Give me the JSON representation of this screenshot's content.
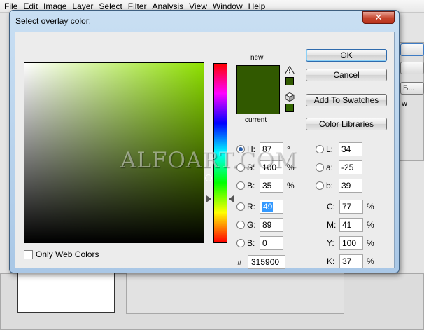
{
  "menu": [
    "File",
    "Edit",
    "Image",
    "Layer",
    "Select",
    "Filter",
    "Analysis",
    "View",
    "Window",
    "Help"
  ],
  "background": {
    "btn1": "Б...",
    "btn2": "w"
  },
  "dialog": {
    "title": "Select overlay color:",
    "close_glyph": "✕",
    "new_label": "new",
    "current_label": "current",
    "new_color": "#315900",
    "current_color": "#315900",
    "gamut_swatch_color": "#315900",
    "web_swatch_color": "#336600",
    "buttons": {
      "ok": "OK",
      "cancel": "Cancel",
      "add_swatches": "Add To Swatches",
      "color_libraries": "Color Libraries"
    },
    "only_web_colors": "Only Web Colors",
    "hsb": [
      {
        "label": "H:",
        "value": "87",
        "unit": "°"
      },
      {
        "label": "S:",
        "value": "100",
        "unit": "%"
      },
      {
        "label": "B:",
        "value": "35",
        "unit": "%"
      }
    ],
    "rgb": [
      {
        "label": "R:",
        "value": "49"
      },
      {
        "label": "G:",
        "value": "89"
      },
      {
        "label": "B:",
        "value": "0"
      }
    ],
    "lab": [
      {
        "label": "L:",
        "value": "34"
      },
      {
        "label": "a:",
        "value": "-25"
      },
      {
        "label": "b:",
        "value": "39"
      }
    ],
    "cmyk": [
      {
        "label": "C:",
        "value": "77",
        "unit": "%"
      },
      {
        "label": "M:",
        "value": "41",
        "unit": "%"
      },
      {
        "label": "Y:",
        "value": "100",
        "unit": "%"
      },
      {
        "label": "K:",
        "value": "37",
        "unit": "%"
      }
    ],
    "hex_label": "#",
    "hex_value": "315900",
    "hue_color": "#8ee000"
  },
  "watermark": "ALFOART.COM"
}
